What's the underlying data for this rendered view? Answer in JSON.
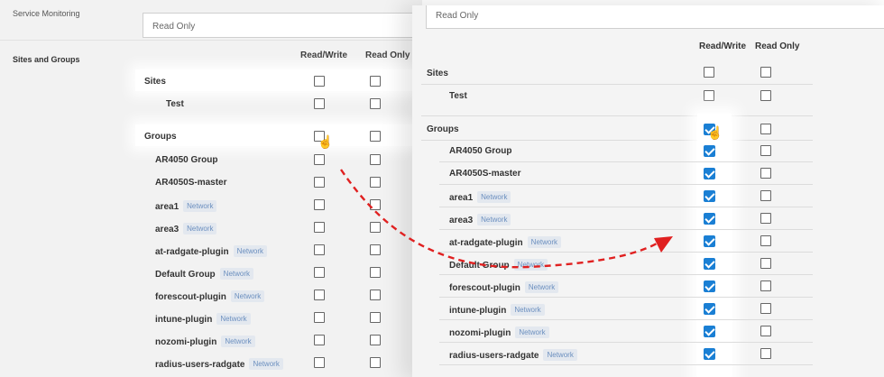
{
  "left": {
    "service_monitoring_label": "Service Monitoring",
    "service_monitoring_value": "Read Only",
    "sites_and_groups_label": "Sites and Groups",
    "col_read_write": "Read/Write",
    "col_read_only": "Read Only",
    "sites_header": "Sites",
    "groups_header": "Groups",
    "sites": [
      {
        "label": "Test",
        "tag": ""
      }
    ],
    "groups": [
      {
        "label": "AR4050 Group",
        "tag": ""
      },
      {
        "label": "AR4050S-master",
        "tag": ""
      },
      {
        "label": "area1",
        "tag": "Network"
      },
      {
        "label": "area3",
        "tag": "Network"
      },
      {
        "label": "at-radgate-plugin",
        "tag": "Network"
      },
      {
        "label": "Default Group",
        "tag": "Network"
      },
      {
        "label": "forescout-plugin",
        "tag": "Network"
      },
      {
        "label": "intune-plugin",
        "tag": "Network"
      },
      {
        "label": "nozomi-plugin",
        "tag": "Network"
      },
      {
        "label": "radius-users-radgate",
        "tag": "Network"
      }
    ]
  },
  "right": {
    "field_value": "Read Only",
    "col_read_write": "Read/Write",
    "col_read_only": "Read Only",
    "sites_header": "Sites",
    "groups_header": "Groups",
    "sites": [
      {
        "label": "Test",
        "tag": ""
      }
    ],
    "groups": [
      {
        "label": "AR4050 Group",
        "tag": "",
        "read_write": true,
        "read_only": false
      },
      {
        "label": "AR4050S-master",
        "tag": "",
        "read_write": true,
        "read_only": false
      },
      {
        "label": "area1",
        "tag": "Network",
        "read_write": true,
        "read_only": false
      },
      {
        "label": "area3",
        "tag": "Network",
        "read_write": true,
        "read_only": false
      },
      {
        "label": "at-radgate-plugin",
        "tag": "Network",
        "read_write": true,
        "read_only": false
      },
      {
        "label": "Default Group",
        "tag": "Network",
        "read_write": true,
        "read_only": false
      },
      {
        "label": "forescout-plugin",
        "tag": "Network",
        "read_write": true,
        "read_only": false
      },
      {
        "label": "intune-plugin",
        "tag": "Network",
        "read_write": true,
        "read_only": false
      },
      {
        "label": "nozomi-plugin",
        "tag": "Network",
        "read_write": true,
        "read_only": false
      },
      {
        "label": "radius-users-radgate",
        "tag": "Network",
        "read_write": true,
        "read_only": false
      }
    ]
  },
  "colors": {
    "checkbox_checked": "#1a7fd4",
    "tag_bg": "#e3e8ef",
    "tag_text": "#6b8fbf",
    "arrow": "#e02020"
  },
  "icons": {
    "pointer": "hand-pointer-icon",
    "arrow": "curved-dashed-arrow-icon"
  }
}
